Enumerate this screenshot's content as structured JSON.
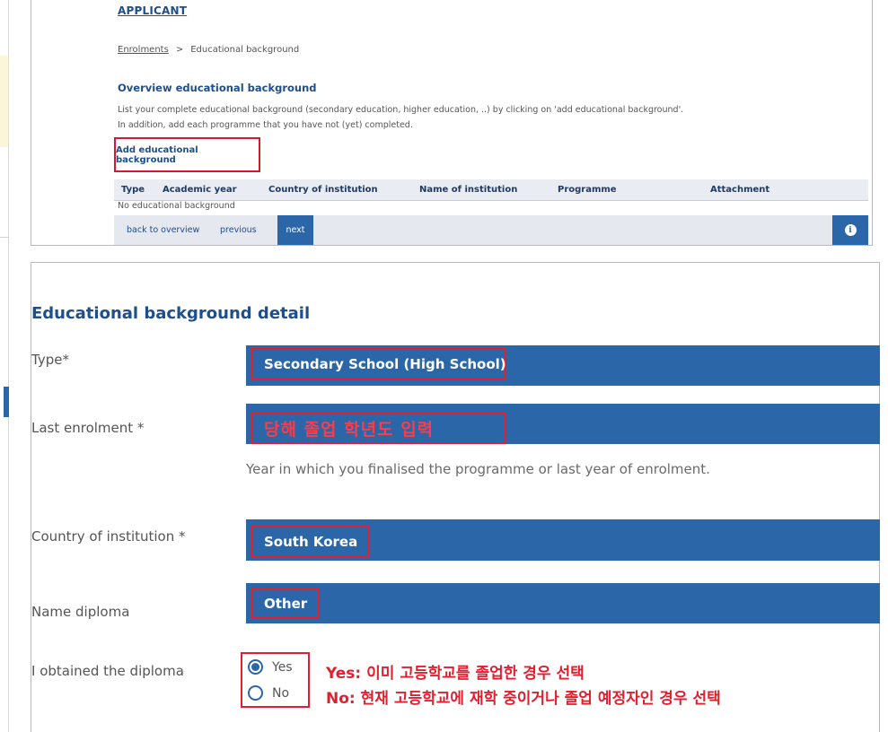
{
  "top_panel": {
    "applicant": "APPLICANT",
    "breadcrumb": {
      "link": "Enrolments",
      "separator": ">",
      "current": "Educational background"
    },
    "overview_title": "Overview educational background",
    "overview_text_line1": "List your complete educational background (secondary education, higher education, ..) by clicking on 'add educational background'.",
    "overview_text_line2": "In addition, add each programme that you have not (yet) completed.",
    "add_button": "Add educational background",
    "table_headers": [
      "Type",
      "Academic year",
      "Country of institution",
      "Name of institution",
      "Programme",
      "Attachment"
    ],
    "empty_message": "No educational background",
    "nav": {
      "back": "back to overview",
      "previous": "previous",
      "next": "next",
      "info_icon": "i"
    }
  },
  "detail": {
    "title": "Educational background detail",
    "type": {
      "label": "Type*",
      "value": "Secondary School (High School)"
    },
    "last_enrolment": {
      "label": "Last enrolment *",
      "value": "당해 졸업 학년도 입력",
      "hint": "Year in which you finalised the programme or last year of enrolment."
    },
    "country": {
      "label": "Country of institution *",
      "value": "South Korea"
    },
    "name_diploma": {
      "label": "Name diploma",
      "value": "Other"
    },
    "obtained": {
      "label": "I obtained the diploma",
      "options": [
        {
          "label": "Yes",
          "selected": true
        },
        {
          "label": "No",
          "selected": false
        }
      ]
    },
    "notes": {
      "yes_key": "Yes:",
      "yes_text": "이미 고등학교를 졸업한 경우 선택",
      "no_key": "No:",
      "no_text": "현재 고등학교에 재학 중이거나 졸업 예정자인 경우 선택"
    }
  },
  "colors": {
    "accent_blue": "#2a66a8",
    "title_blue": "#1e4e8c",
    "annotation_red": "#e0202e"
  }
}
